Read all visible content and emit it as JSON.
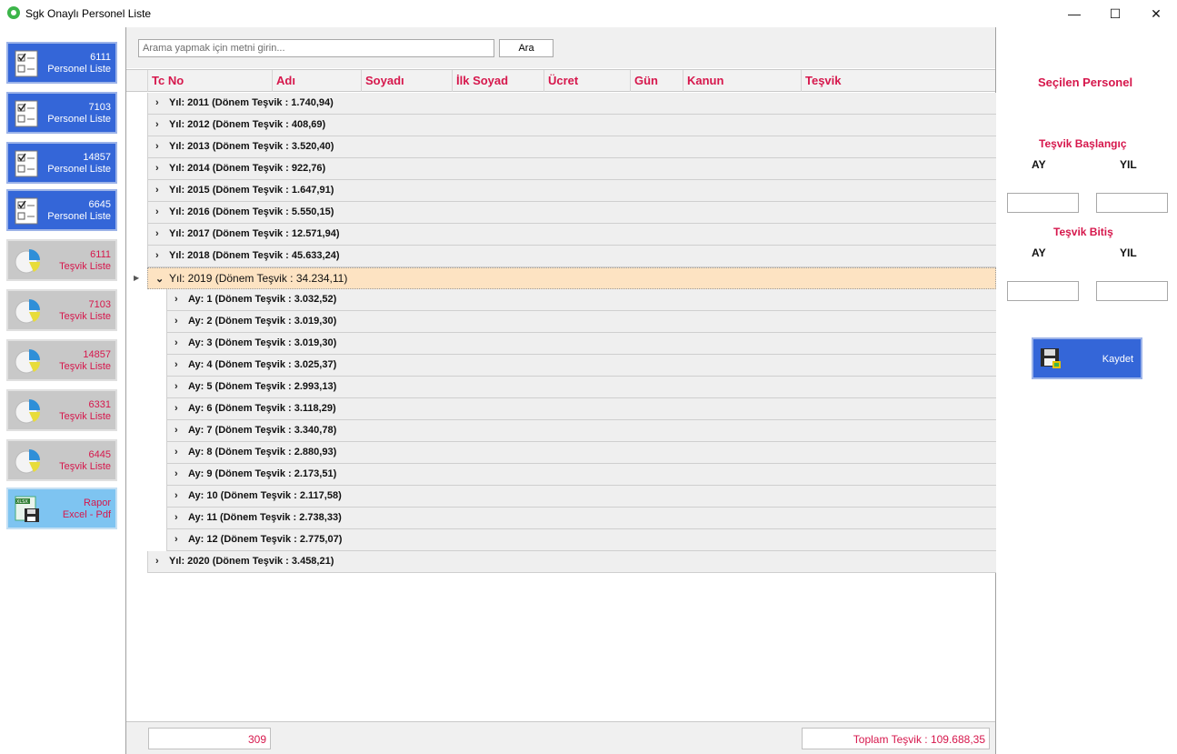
{
  "window": {
    "title": "Sgk Onaylı Personel Liste",
    "minimize": "—",
    "maximize": "☐",
    "close": "✕"
  },
  "sidebar": [
    {
      "line1": "6111",
      "line2": "Personel Liste",
      "style": "blue",
      "icon": "checklist-icon"
    },
    {
      "line1": "7103",
      "line2": "Personel Liste",
      "style": "blue",
      "icon": "checklist-icon"
    },
    {
      "line1": "14857",
      "line2": "Personel Liste",
      "style": "blue",
      "icon": "checklist-icon"
    },
    {
      "line1": "6645",
      "line2": "Personel Liste",
      "style": "blue",
      "icon": "checklist-icon"
    },
    {
      "line1": "6111",
      "line2": "Teşvik Liste",
      "style": "gray",
      "icon": "pie-chart-icon"
    },
    {
      "line1": "7103",
      "line2": "Teşvik Liste",
      "style": "gray",
      "icon": "pie-chart-icon"
    },
    {
      "line1": "14857",
      "line2": "Teşvik Liste",
      "style": "gray",
      "icon": "pie-chart-icon"
    },
    {
      "line1": "6331",
      "line2": "Teşvik Liste",
      "style": "gray",
      "icon": "pie-chart-icon"
    },
    {
      "line1": "6445",
      "line2": "Teşvik Liste",
      "style": "gray",
      "icon": "pie-chart-icon"
    },
    {
      "line1": "Rapor",
      "line2": "Excel - Pdf",
      "style": "light",
      "icon": "xlsx-save-icon"
    }
  ],
  "search": {
    "placeholder": "Arama yapmak için metni girin...",
    "button": "Ara"
  },
  "columns": [
    "Tc No",
    "Adı",
    "Soyadı",
    "İlk Soyad",
    "Ücret",
    "Gün",
    "Kanun",
    "Teşvik"
  ],
  "groups": [
    {
      "text": "Yıl: 2011 (Dönem Teşvik : 1.740,94)",
      "expanded": false
    },
    {
      "text": "Yıl: 2012 (Dönem Teşvik : 408,69)",
      "expanded": false
    },
    {
      "text": "Yıl: 2013 (Dönem Teşvik : 3.520,40)",
      "expanded": false
    },
    {
      "text": "Yıl: 2014 (Dönem Teşvik : 922,76)",
      "expanded": false
    },
    {
      "text": "Yıl: 2015 (Dönem Teşvik : 1.647,91)",
      "expanded": false
    },
    {
      "text": "Yıl: 2016 (Dönem Teşvik : 5.550,15)",
      "expanded": false
    },
    {
      "text": "Yıl: 2017 (Dönem Teşvik : 12.571,94)",
      "expanded": false
    },
    {
      "text": "Yıl: 2018 (Dönem Teşvik : 45.633,24)",
      "expanded": false
    },
    {
      "text": "Yıl: 2019 (Dönem Teşvik : 34.234,11)",
      "expanded": true,
      "children": [
        "Ay: 1 (Dönem Teşvik : 3.032,52)",
        "Ay: 2 (Dönem Teşvik : 3.019,30)",
        "Ay: 3 (Dönem Teşvik : 3.019,30)",
        "Ay: 4 (Dönem Teşvik : 3.025,37)",
        "Ay: 5 (Dönem Teşvik : 2.993,13)",
        "Ay: 6 (Dönem Teşvik : 3.118,29)",
        "Ay: 7 (Dönem Teşvik : 3.340,78)",
        "Ay: 8 (Dönem Teşvik : 2.880,93)",
        "Ay: 9 (Dönem Teşvik : 2.173,51)",
        "Ay: 10 (Dönem Teşvik : 2.117,58)",
        "Ay: 11 (Dönem Teşvik : 2.738,33)",
        "Ay: 12 (Dönem Teşvik : 2.775,07)"
      ]
    },
    {
      "text": "Yıl: 2020 (Dönem Teşvik : 3.458,21)",
      "expanded": false
    }
  ],
  "footer": {
    "count": "309",
    "total": "Toplam Teşvik : 109.688,35"
  },
  "right": {
    "title": "Seçilen Personel",
    "start_label": "Teşvik Başlangıç",
    "end_label": "Teşvik Bitiş",
    "ay": "AY",
    "yil": "YIL",
    "save": "Kaydet"
  },
  "colors": {
    "accent_red": "#d6174c",
    "button_blue": "#3466d8",
    "selected_row": "#fde3c2"
  }
}
